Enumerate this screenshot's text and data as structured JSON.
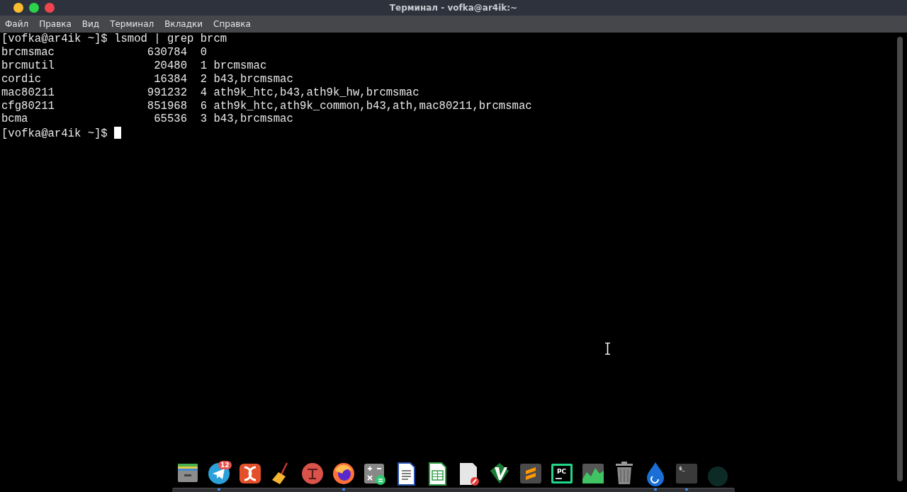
{
  "window": {
    "title": "Терминал - vofka@ar4ik:~"
  },
  "menu": [
    "Файл",
    "Правка",
    "Вид",
    "Терминал",
    "Вкладки",
    "Справка"
  ],
  "terminal": {
    "lines": [
      "[vofka@ar4ik ~]$ lsmod | grep brcm",
      "brcmsmac              630784  0",
      "brcmutil               20480  1 brcmsmac",
      "cordic                 16384  2 b43,brcmsmac",
      "mac80211              991232  4 ath9k_htc,b43,ath9k_hw,brcmsmac",
      "cfg80211              851968  6 ath9k_htc,ath9k_common,b43,ath,mac80211,brcmsmac",
      "bcma                   65536  3 b43,brcmsmac"
    ],
    "prompt": "[vofka@ar4ik ~]$ "
  },
  "dock": [
    {
      "kind": "files",
      "running": false
    },
    {
      "kind": "telegram",
      "running": true,
      "badge": "12"
    },
    {
      "kind": "dc",
      "running": false
    },
    {
      "kind": "broom",
      "running": false
    },
    {
      "kind": "redcircle",
      "running": false
    },
    {
      "kind": "firefox",
      "running": true
    },
    {
      "kind": "calculator",
      "running": false
    },
    {
      "kind": "writer",
      "running": false
    },
    {
      "kind": "sheet",
      "running": false
    },
    {
      "kind": "draw",
      "running": false
    },
    {
      "kind": "vim",
      "running": false
    },
    {
      "kind": "sublime",
      "running": false
    },
    {
      "kind": "pycharm",
      "running": false,
      "label": "PC"
    },
    {
      "kind": "monitor",
      "running": false
    },
    {
      "kind": "trash",
      "running": false
    },
    {
      "kind": "drop",
      "running": true
    },
    {
      "kind": "terminal",
      "running": true,
      "label": "$_"
    },
    {
      "kind": "faded",
      "running": false
    }
  ]
}
